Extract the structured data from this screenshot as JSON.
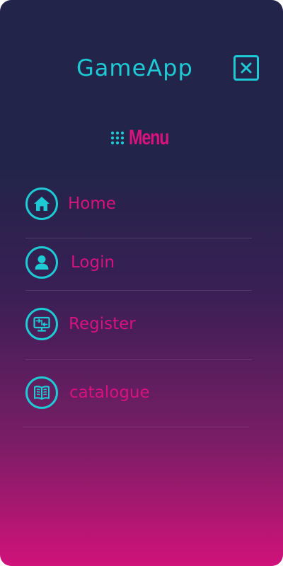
{
  "app": {
    "title": "GameApp"
  },
  "menu": {
    "heading": "Menu",
    "items": [
      {
        "label": "Home",
        "icon": "home-icon"
      },
      {
        "label": "Login",
        "icon": "user-icon"
      },
      {
        "label": "Register",
        "icon": "register-icon"
      },
      {
        "label": "catalogue",
        "icon": "book-icon"
      }
    ]
  },
  "colors": {
    "accent": "#1ecad3",
    "brand": "#d8127e",
    "background_top": "#23244a",
    "background_bottom": "#d0127a"
  }
}
